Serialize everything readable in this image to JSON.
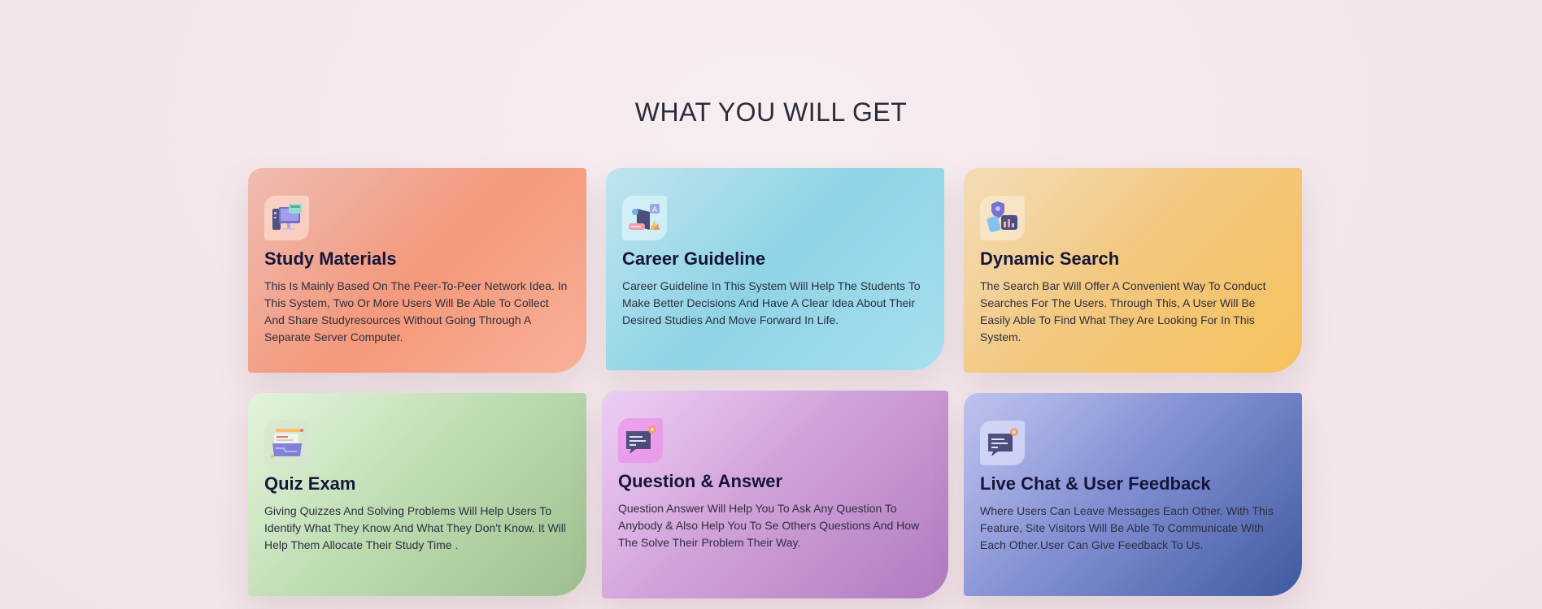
{
  "section": {
    "title": "WHAT YOU WILL GET"
  },
  "cards": [
    {
      "title": "Study Materials",
      "text": "This Is Mainly Based On The Peer-To-Peer Network Idea. In This System, Two Or More Users Will Be Able To Collect And Share Studyresources Without Going Through A Separate Server Computer.",
      "icon": "computer-books-icon",
      "accent": "#f59a7c"
    },
    {
      "title": "Career Guideline",
      "text": "Career Guideline In This System Will Help The Students To Make Better Decisions And Have A Clear Idea About Their Desired Studies And Move Forward In Life.",
      "icon": "graduation-guide-icon",
      "accent": "#8fd4e5"
    },
    {
      "title": "Dynamic Search",
      "text": "The Search Bar Will Offer A Convenient Way To Conduct Searches For The Users. Through This, A User Will Be Easily Able To Find What They Are Looking For In This System.",
      "icon": "search-shield-icon",
      "accent": "#f5c25c"
    },
    {
      "title": "Quiz Exam",
      "text": "Giving Quizzes And Solving Problems Will Help Users To Identify What They Know And What They Don't Know. It Will Help Them Allocate Their Study Time .",
      "icon": "quiz-folder-icon",
      "accent": "#9dbf8f"
    },
    {
      "title": "Question & Answer",
      "text": "Question Answer Will Help You To Ask Any Question To Anybody & Also Help You To Se Others Questions And How The Solve Their Problem Their Way.",
      "icon": "chat-bubble-icon",
      "accent": "#b07ac0"
    },
    {
      "title": "Live Chat & User Feedback",
      "text": "Where Users Can Leave Messages Each Other. With This Feature, Site Visitors Will Be Able To Communicate With Each Other.User Can Give Feedback To Us.",
      "icon": "live-chat-icon",
      "accent": "#3f5aa0"
    }
  ]
}
